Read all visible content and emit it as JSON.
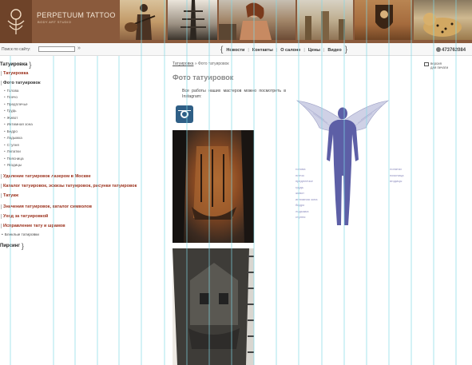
{
  "header": {
    "brand": "PERPETUUM TATTOO",
    "brand_sub": "BODY ART STUDIO"
  },
  "toolbar": {
    "search_label": "Поиск по сайту:",
    "search_value": "",
    "search_go": "»",
    "nav": [
      "Новости",
      "Контакты",
      "О салоне",
      "Цены",
      "Видео"
    ],
    "phone": "473762084"
  },
  "sidebar": {
    "tattoo_title": "Татуировка",
    "tattoo_link": "Татуировка",
    "photo_link": "Фото татуировок",
    "body_parts": [
      "Голова",
      "Плечо",
      "Предплечье",
      "Грудь",
      "Живот",
      "Интимная зона",
      "Бедро",
      "Лодыжка",
      "Ступня",
      "Лопатки",
      "Поясница",
      "Ягодицы"
    ],
    "links_red": [
      "Удаление татуировок лазером в Москве",
      "Каталог татуировок, эскизы татуировок, рисунки татуировок",
      "Татуаж",
      "Значения татуировок, каталог символов",
      "Уход за татуировкой",
      "Исправление тату и шрамов"
    ],
    "plain_link": "Блеклые татировки",
    "piercing_title": "Пирсинг"
  },
  "main": {
    "breadcrumb_link": "Татуировка",
    "breadcrumb_sep": " » ",
    "breadcrumb_current": "Фото татуировок",
    "title": "Фото татуировок",
    "intro": "Все работы наших мастеров можно посмотреть в Instagram:"
  },
  "body_map": {
    "version_text": [
      "версия",
      "для печати"
    ],
    "left_labels": [
      "голова",
      "плечо",
      "предплечье",
      "грудь",
      "живот",
      "интимная зона",
      "бедро",
      "лодыжка",
      "ступня"
    ],
    "right_labels": [
      "лопатки",
      "поясница",
      "ягодицы"
    ],
    "figure_color": "#5d5fa6"
  },
  "colors": {
    "header_brown": "#8a5a3c",
    "link_red": "#9a2f1a",
    "guide_cyan": "#7fd8e6"
  }
}
